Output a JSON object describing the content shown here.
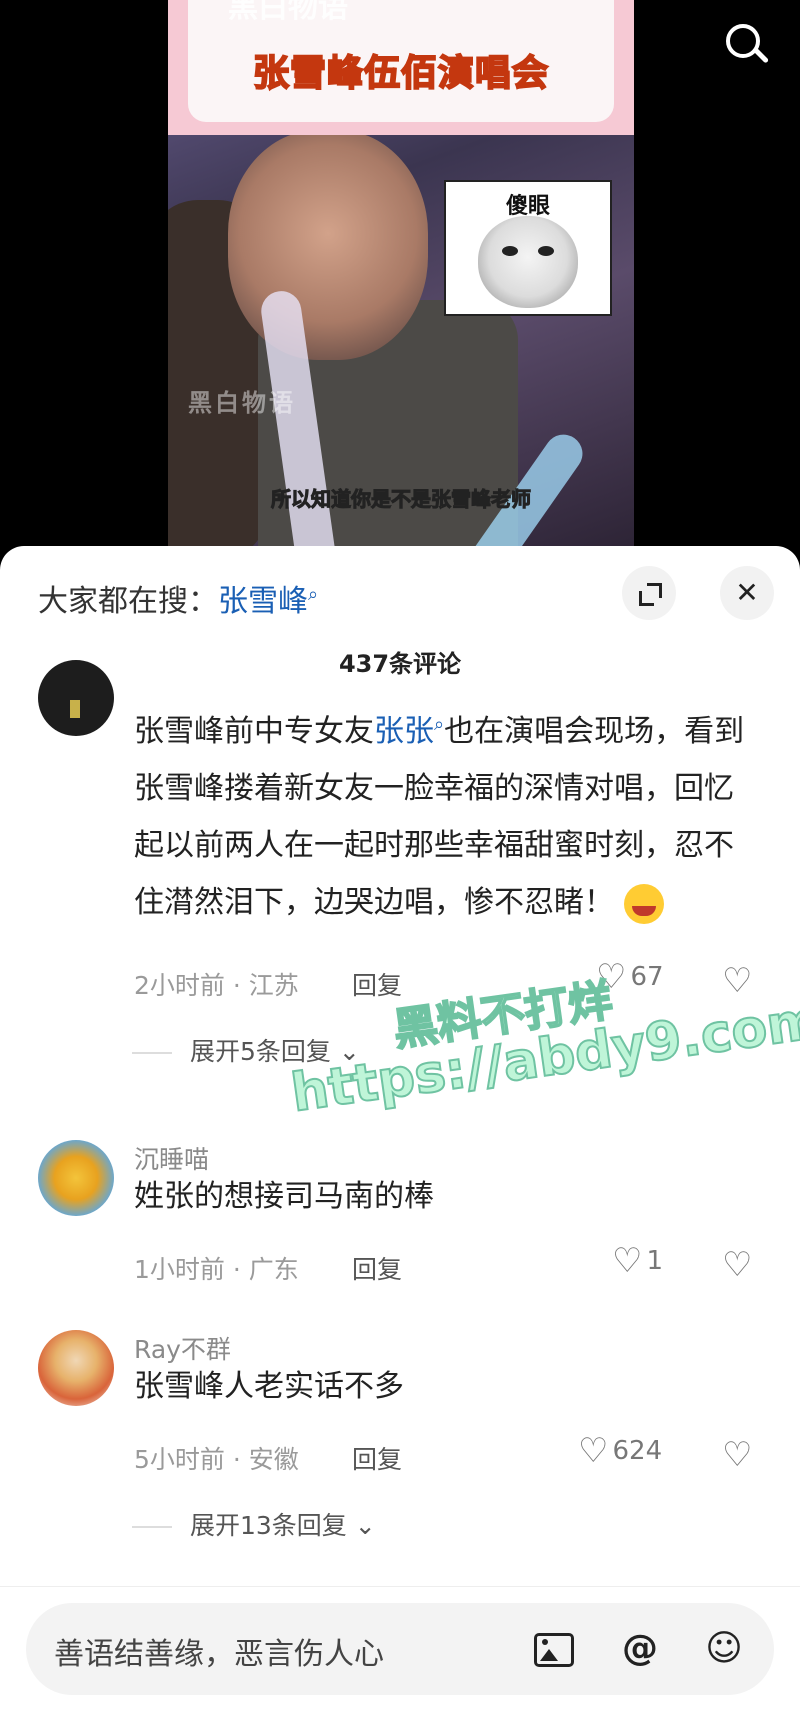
{
  "video": {
    "banner_title": "张雪峰伍佰演唱会",
    "banner_top_text": "黑白物语",
    "meme_label": "傻眼",
    "watermark": "黑白物语",
    "subtitle": "所以知道你是不是张雪峰老师",
    "search_icon": "search-icon"
  },
  "sheet": {
    "hot_search_label": "大家都在搜：",
    "hot_search_keyword": "张雪峰",
    "comment_count": "437条评论",
    "expand_icon": "expand-icon",
    "close_icon": "close-icon"
  },
  "comments": [
    {
      "text_part1": "张雪峰前中专女友",
      "keyword": "张张",
      "text_part2": "也在演唱会现场，看到张雪峰搂着新女友一脸幸福的深情对唱，回忆起以前两人在一起时那些幸福甜蜜时刻，忍不住潸然泪下，边哭边唱，惨不忍睹！",
      "time_location": "2小时前 · 江苏",
      "reply_label": "回复",
      "likes": "67",
      "expand_replies": "展开5条回复"
    },
    {
      "username": "沉睡喵",
      "text": "姓张的想接司马南的棒",
      "time_location": "1小时前 · 广东",
      "reply_label": "回复",
      "likes": "1"
    },
    {
      "username": "Ray不群",
      "text": "张雪峰人老实话不多",
      "time_location": "5小时前 · 安徽",
      "reply_label": "回复",
      "likes": "624",
      "expand_replies": "展开13条回复"
    }
  ],
  "overlay_watermark": {
    "line1": "黑料不打烊",
    "line2": "https://abdy9.com"
  },
  "input": {
    "placeholder": "善语结善缘，恶言伤人心",
    "image_icon": "image-icon",
    "at_icon": "at-icon",
    "emoji_icon": "emoji-icon"
  },
  "colors": {
    "link": "#1a5fb4",
    "banner_pink": "#f6c9d4",
    "watermark_green": "#bff5d8"
  }
}
